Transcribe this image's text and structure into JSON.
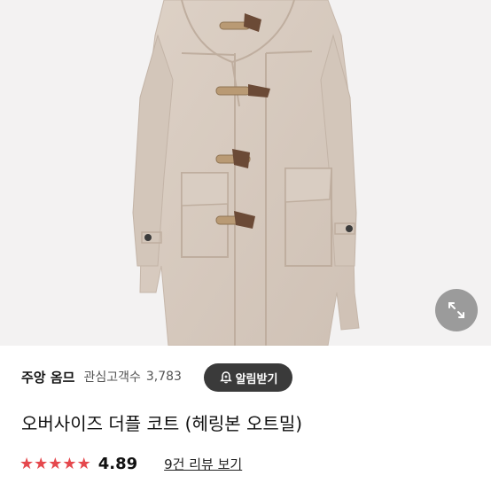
{
  "product": {
    "title": "오버사이즈 더플 코트 (헤링본 오트밀)",
    "image_alt_icon": "coat-photo"
  },
  "seller": {
    "name": "주앙 옴므",
    "follower_label": "관심고객수",
    "follower_count": "3,783",
    "alarm_button_label": "알림받기",
    "alarm_icon": "bell-plus-icon"
  },
  "rating": {
    "value": "4.89",
    "stars": 5,
    "review_link": "9건 리뷰 보기"
  },
  "colors": {
    "star": "#e5484d",
    "alarm_bg": "#3a3a3a",
    "hero_bg": "#f3f2f2",
    "coat": "#d8cbc0"
  },
  "controls": {
    "expand_icon": "expand-arrows-icon"
  }
}
